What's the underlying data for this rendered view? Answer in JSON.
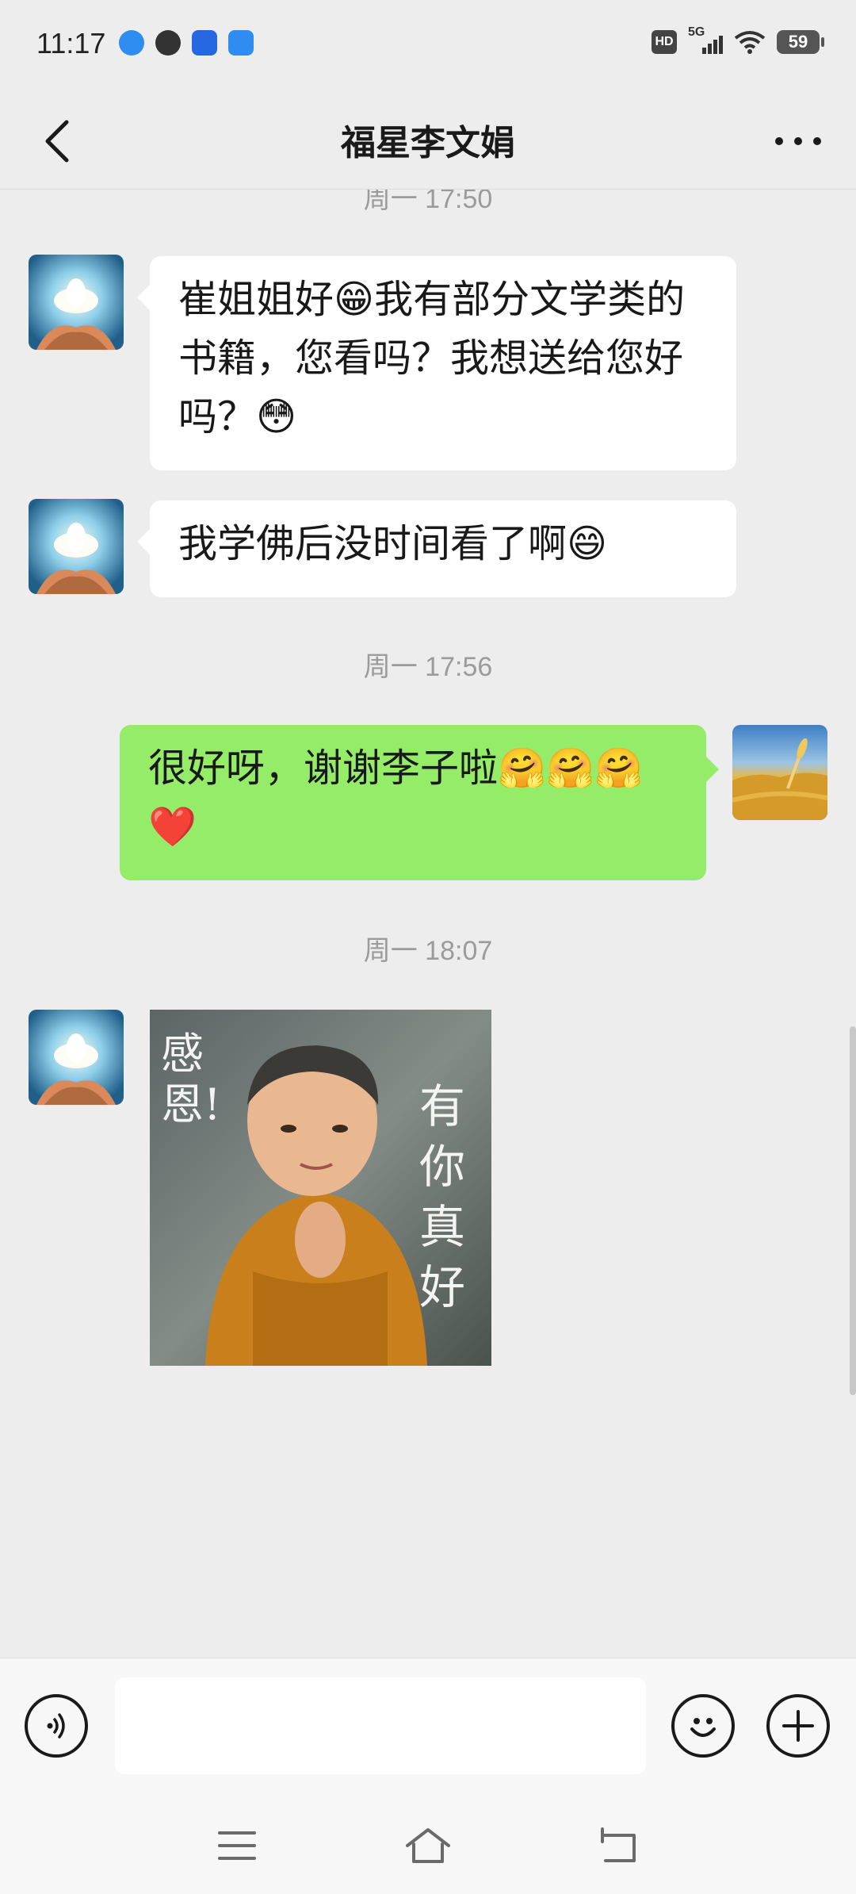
{
  "status_bar": {
    "time": "11:17",
    "signal_label": "5G",
    "hd_label": "HD",
    "battery": "59"
  },
  "header": {
    "title": "福星李文娟"
  },
  "messages": [
    {
      "time": "周一 17:50"
    },
    {
      "side": "left",
      "text": "崔姐姐好😁我有部分文学类的书籍，您看吗？我想送给您好吗？😳"
    },
    {
      "side": "left",
      "text": "我学佛后没时间看了啊😄"
    },
    {
      "time": "周一 17:56"
    },
    {
      "side": "right",
      "text": "很好呀，谢谢李子啦🤗🤗🤗❤️"
    },
    {
      "time": "周一 18:07"
    },
    {
      "side": "left",
      "image_text_left": "感恩!",
      "image_text_right": "有你真好"
    }
  ],
  "input": {
    "placeholder": ""
  },
  "colors": {
    "background": "#ededed",
    "my_bubble": "#95ec69",
    "their_bubble": "#ffffff"
  }
}
